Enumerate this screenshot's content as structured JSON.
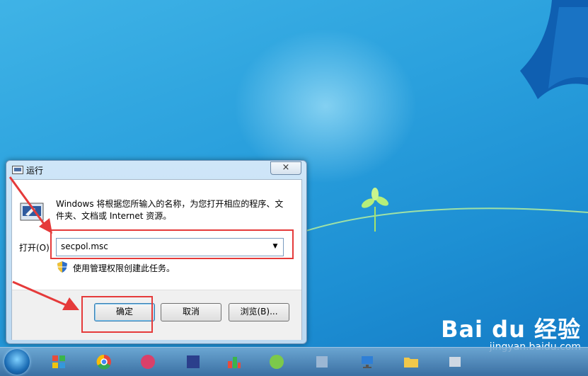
{
  "dialog": {
    "title": "运行",
    "description": "Windows 将根据您所输入的名称，为您打开相应的程序、文件夹、文档或 Internet 资源。",
    "open_label": "打开(O):",
    "command_value": "secpol.msc",
    "admin_note": "使用管理权限创建此任务。",
    "ok_label": "确定",
    "cancel_label": "取消",
    "browse_label": "浏览(B)...",
    "close_glyph": "×"
  },
  "watermark": {
    "brand": "Bai du 经验",
    "url": "jingyan.baidu.com"
  },
  "taskbar": {
    "items": [
      "start",
      "app-1",
      "chrome",
      "app-3",
      "app-4",
      "app-5",
      "app-6",
      "app-7",
      "network",
      "folder",
      "app-10"
    ]
  },
  "colors": {
    "highlight": "#e53a3a",
    "desktop": "#2aa0dd"
  }
}
